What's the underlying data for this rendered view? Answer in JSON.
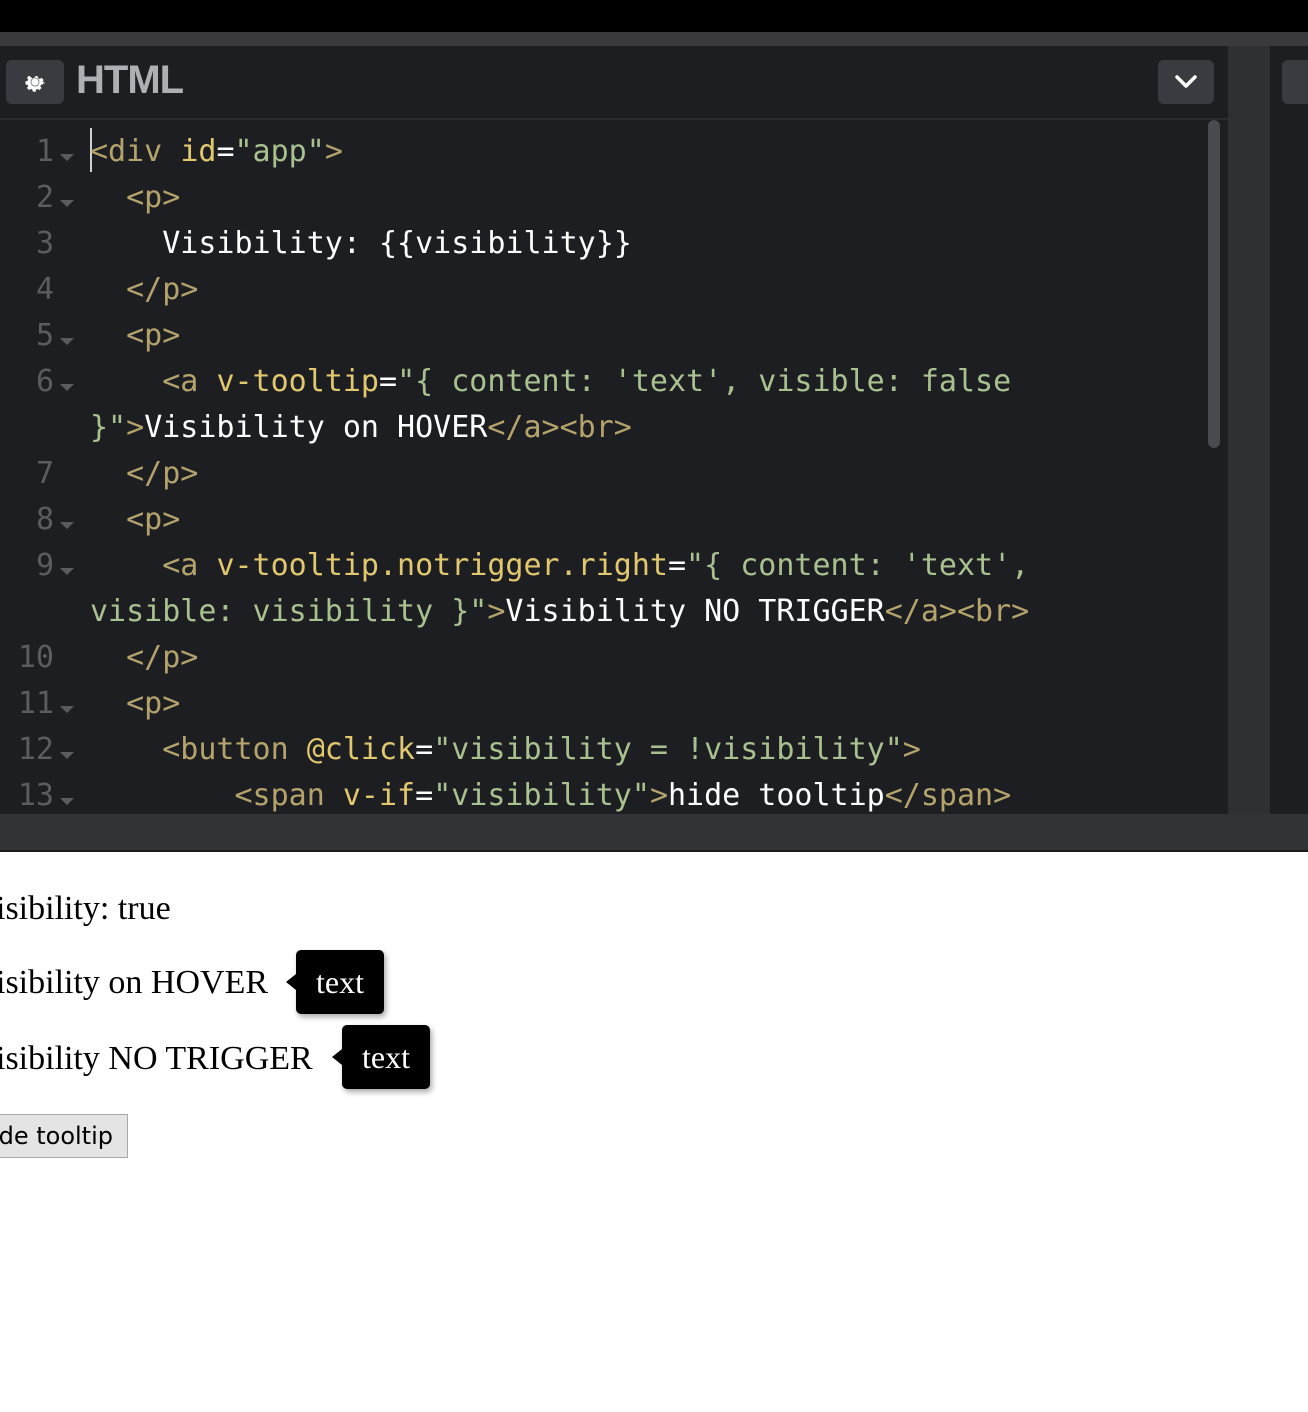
{
  "editor": {
    "title": "HTML",
    "gear_icon": "gear-icon",
    "collapse_icon": "chevron-down-icon",
    "lines": [
      {
        "num": "1",
        "fold": true
      },
      {
        "num": "2",
        "fold": true
      },
      {
        "num": "3",
        "fold": false
      },
      {
        "num": "4",
        "fold": false
      },
      {
        "num": "5",
        "fold": true
      },
      {
        "num": "6",
        "fold": true
      },
      {
        "num": "7",
        "fold": false
      },
      {
        "num": "8",
        "fold": true
      },
      {
        "num": "9",
        "fold": true
      },
      {
        "num": "10",
        "fold": false
      },
      {
        "num": "11",
        "fold": true
      },
      {
        "num": "12",
        "fold": true
      },
      {
        "num": "13",
        "fold": true
      }
    ],
    "code": {
      "l1": [
        [
          "tag",
          "<div "
        ],
        [
          "attr",
          "id"
        ],
        [
          "txt",
          "="
        ],
        [
          "str",
          "\"app\""
        ],
        [
          "tag",
          ">"
        ]
      ],
      "l2": [
        [
          "tag",
          "  <p>"
        ]
      ],
      "l3": [
        [
          "txt",
          "    Visibility: {{visibility}}"
        ]
      ],
      "l4": [
        [
          "tag",
          "  </p>"
        ]
      ],
      "l5": [
        [
          "tag",
          "  <p>"
        ]
      ],
      "l6a": [
        [
          "tag",
          "    <a "
        ],
        [
          "attr",
          "v-tooltip"
        ],
        [
          "txt",
          "="
        ],
        [
          "str",
          "\"{ content: 'text', visible: false"
        ]
      ],
      "l6b": [
        [
          "str",
          "}\""
        ],
        [
          "tag",
          ">"
        ],
        [
          "txt",
          "Visibility on HOVER"
        ],
        [
          "tag",
          "</a><br>"
        ]
      ],
      "l7": [
        [
          "tag",
          "  </p>"
        ]
      ],
      "l8": [
        [
          "tag",
          "  <p>"
        ]
      ],
      "l9a": [
        [
          "tag",
          "    <a "
        ],
        [
          "attr",
          "v-tooltip.notrigger.right"
        ],
        [
          "txt",
          "="
        ],
        [
          "str",
          "\"{ content: 'text',"
        ]
      ],
      "l9b": [
        [
          "str",
          "visible: visibility }\""
        ],
        [
          "tag",
          ">"
        ],
        [
          "txt",
          "Visibility NO TRIGGER"
        ],
        [
          "tag",
          "</a><br>"
        ]
      ],
      "l10": [
        [
          "tag",
          "  </p>"
        ]
      ],
      "l11": [
        [
          "tag",
          "  <p>"
        ]
      ],
      "l12": [
        [
          "tag",
          "    <button "
        ],
        [
          "attr",
          "@click"
        ],
        [
          "txt",
          "="
        ],
        [
          "str",
          "\"visibility = !visibility\""
        ],
        [
          "tag",
          ">"
        ]
      ],
      "l13": [
        [
          "tag",
          "        <span "
        ],
        [
          "attr",
          "v-if"
        ],
        [
          "txt",
          "="
        ],
        [
          "str",
          "\"visibility\""
        ],
        [
          "tag",
          ">"
        ],
        [
          "txt",
          "hide tooltip"
        ],
        [
          "tag",
          "</span>"
        ]
      ]
    }
  },
  "preview": {
    "line1": "isibility: true",
    "line2": "isibility on HOVER",
    "line3": "isibility NO TRIGGER",
    "tooltip1": "text",
    "tooltip2": "text",
    "button_label": "ide tooltip"
  }
}
